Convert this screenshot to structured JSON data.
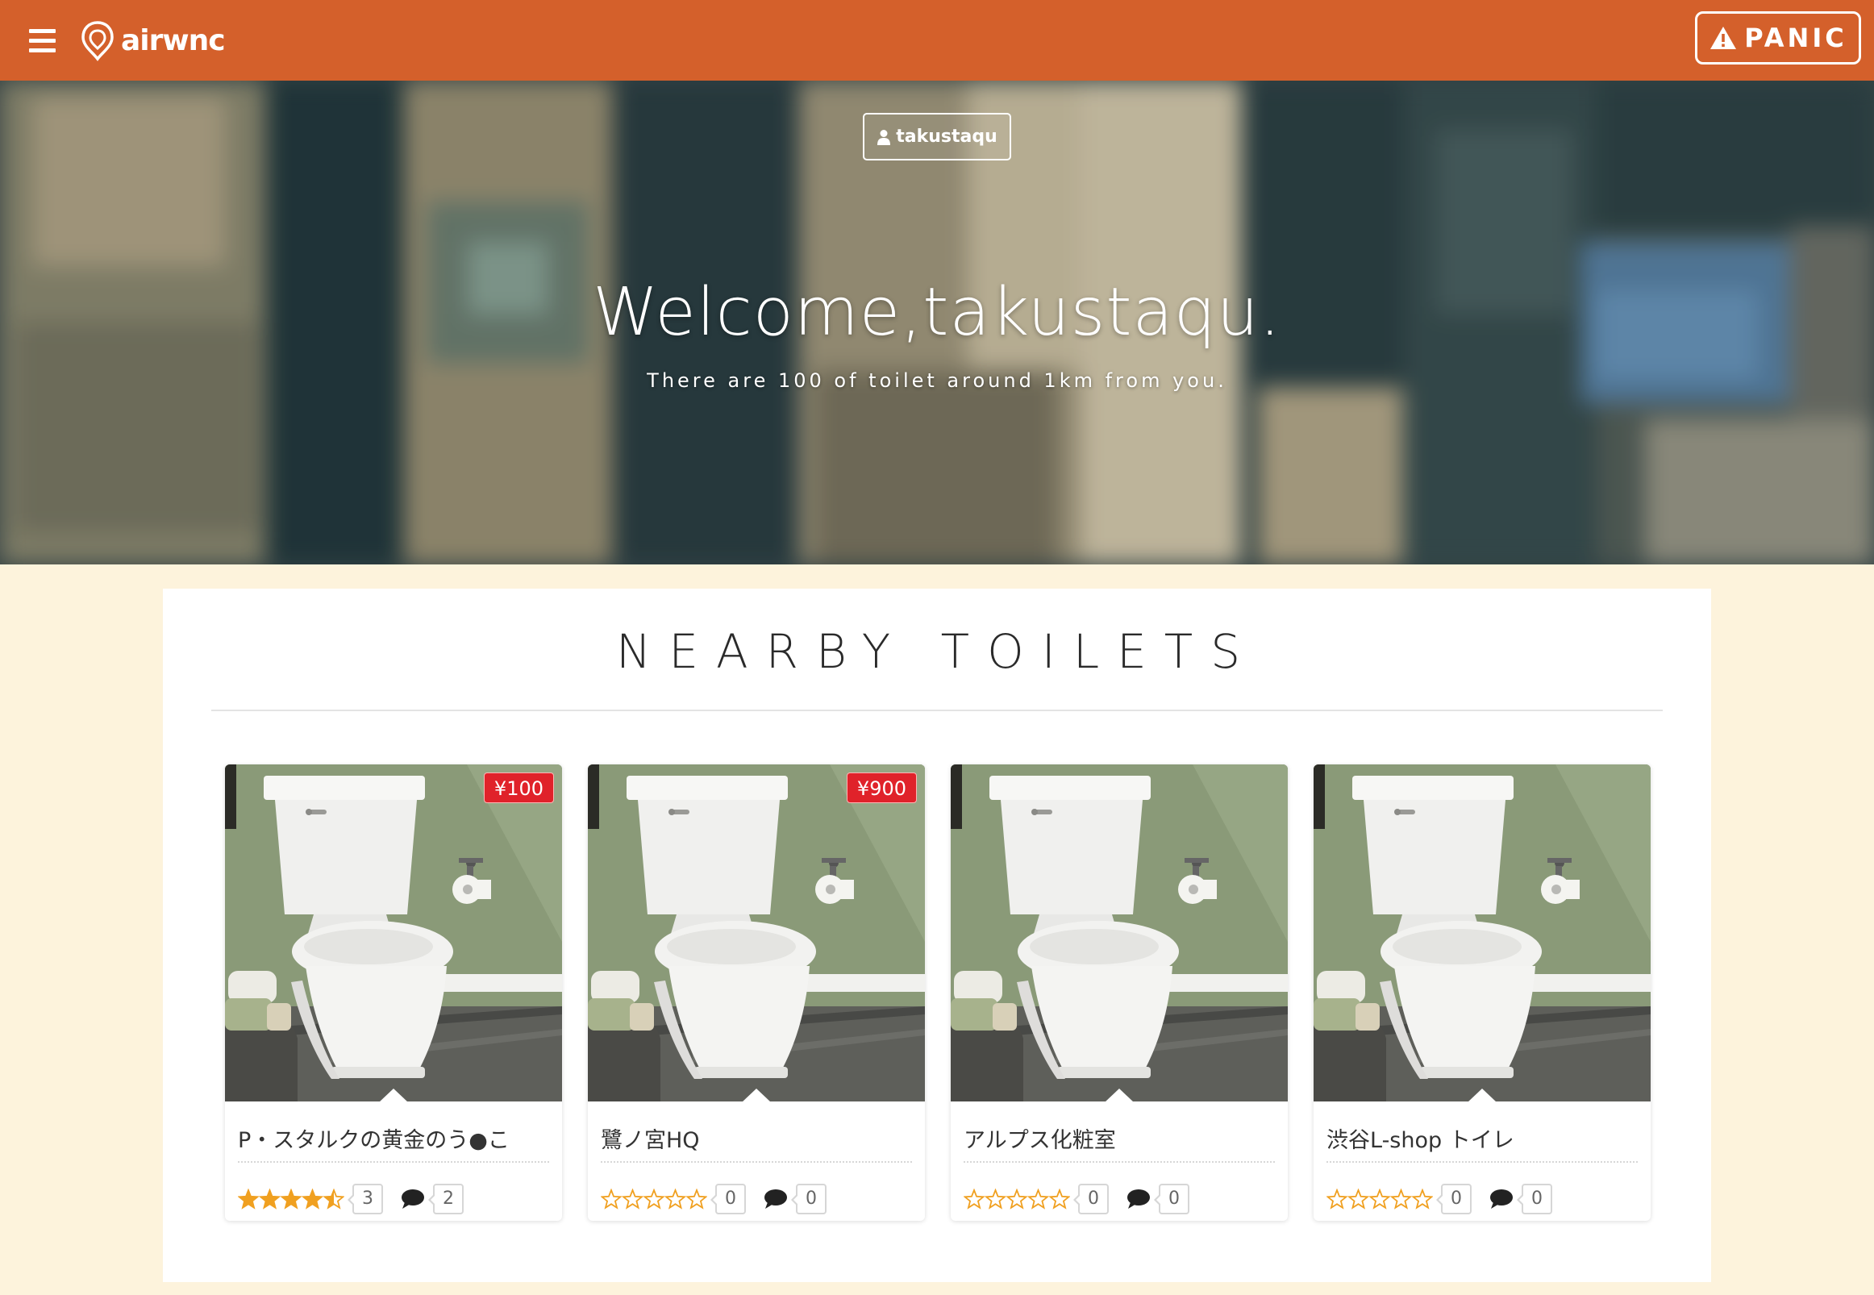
{
  "navbar": {
    "brand": "airwnc",
    "panic_label": "PANIC"
  },
  "hero": {
    "user_button": "takustaqu",
    "welcome": "Welcome,takustaqu.",
    "subtitle": "There are 100 of toilet around 1km from you."
  },
  "section": {
    "title": "NEARBY TOILETS"
  },
  "toilets": [
    {
      "name": "P・スタルクの黄金のう●こ",
      "price": "¥100",
      "rating": 4.5,
      "rating_count": "3",
      "comment_count": "2"
    },
    {
      "name": "鷺ノ宮HQ",
      "price": "¥900",
      "rating": 0,
      "rating_count": "0",
      "comment_count": "0"
    },
    {
      "name": "アルプス化粧室",
      "price": "",
      "rating": 0,
      "rating_count": "0",
      "comment_count": "0"
    },
    {
      "name": "渋谷L-shop トイレ",
      "price": "",
      "rating": 0,
      "rating_count": "0",
      "comment_count": "0"
    }
  ],
  "colors": {
    "navbar": "#d4602b",
    "page_background": "#fdf3dc",
    "price_badge": "#e0222a",
    "star": "#f0a020"
  },
  "icons": [
    "menu-icon",
    "airwnc-logo-icon",
    "warning-icon",
    "user-icon",
    "star-icon",
    "comment-icon"
  ]
}
